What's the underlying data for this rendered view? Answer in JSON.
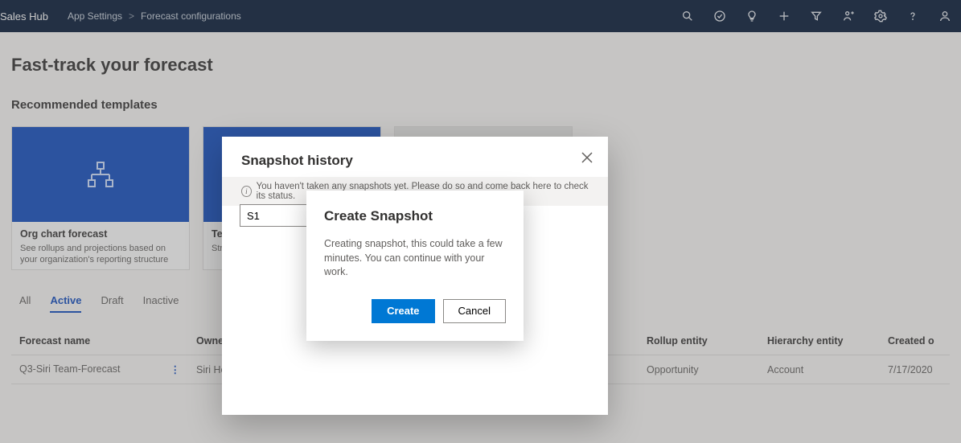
{
  "header": {
    "brand": "Sales Hub",
    "breadcrumb": [
      "App Settings",
      "Forecast configurations"
    ]
  },
  "page": {
    "title": "Fast-track your forecast",
    "section": "Recommended templates"
  },
  "cards": [
    {
      "title": "Org chart forecast",
      "desc": "See rollups and projections based on your organization's reporting structure"
    },
    {
      "title": "Te",
      "desc": "Str\npro"
    }
  ],
  "tabs": [
    "All",
    "Active",
    "Draft",
    "Inactive"
  ],
  "active_tab": "Active",
  "table": {
    "columns": [
      "Forecast name",
      "Owner",
      "Rollup entity",
      "Hierarchy entity",
      "Created o"
    ],
    "rows": [
      {
        "name": "Q3-Siri Team-Forecast",
        "owner": "Siri Hed",
        "rollup": "Opportunity",
        "hierarchy": "Account",
        "created": "7/17/2020"
      }
    ]
  },
  "dialog": {
    "title": "Snapshot history",
    "info": "You haven't taken any snapshots yet. Please do so and come back here to check its status.",
    "input_value": "S1"
  },
  "confirm": {
    "title": "Create Snapshot",
    "message": "Creating snapshot, this could take a few minutes. You can continue with your work.",
    "primary": "Create",
    "secondary": "Cancel"
  }
}
